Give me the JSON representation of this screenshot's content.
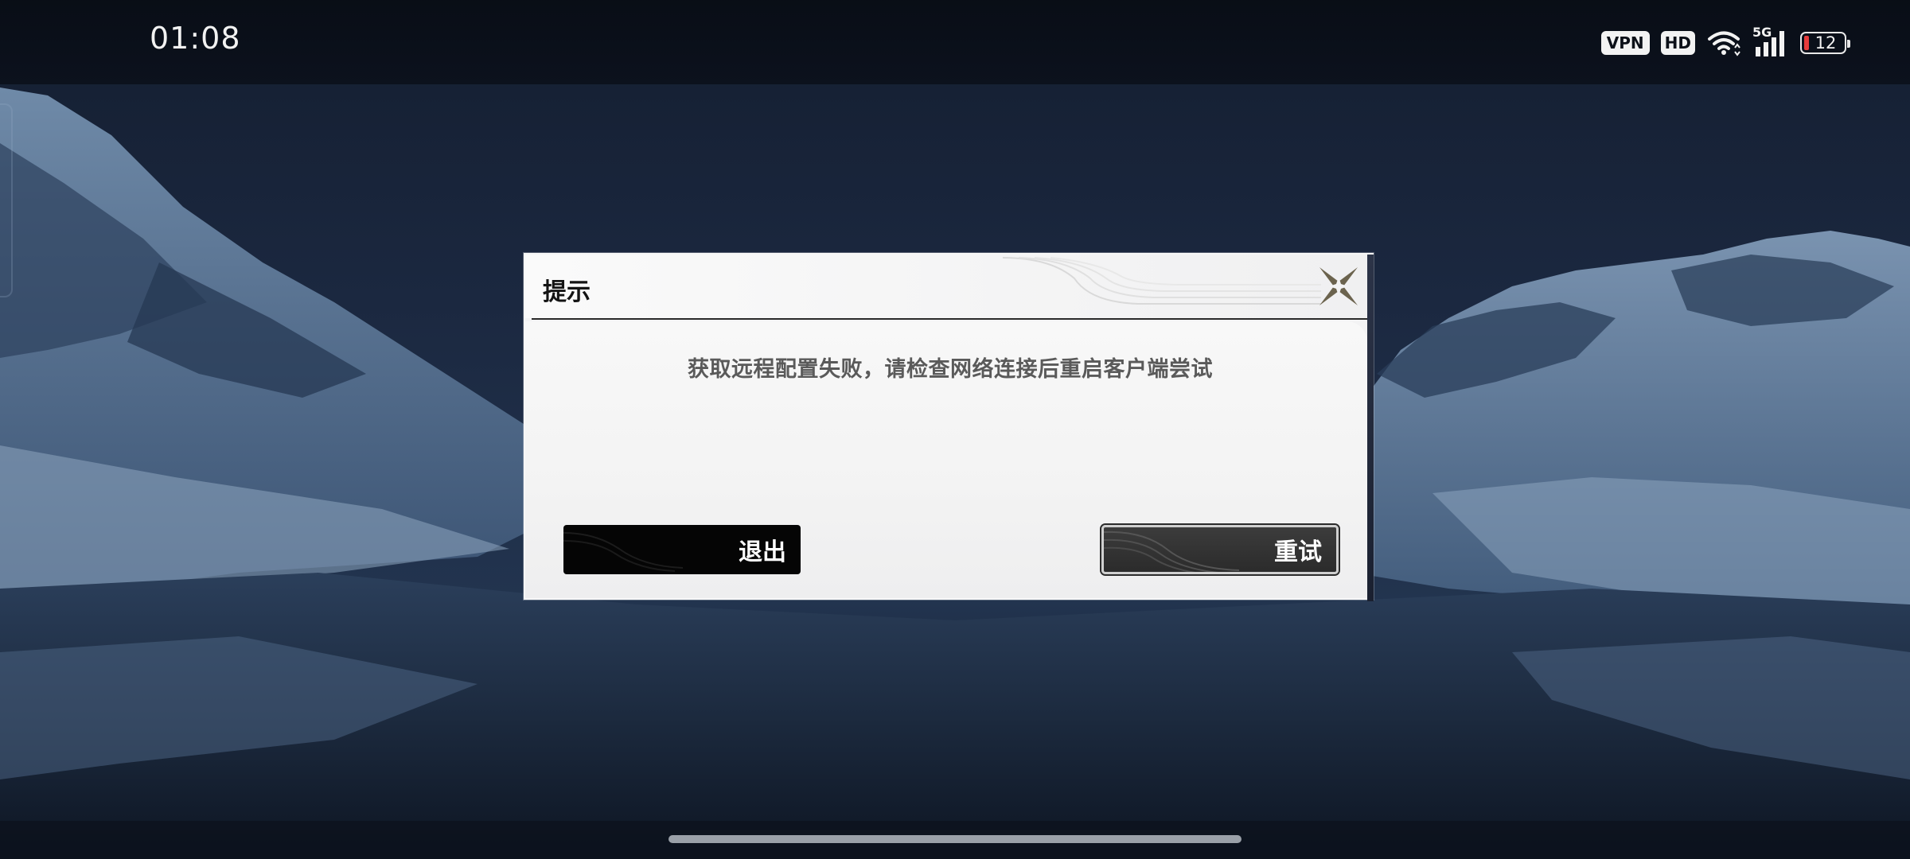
{
  "status_bar": {
    "time": "01:08",
    "vpn_label": "VPN",
    "hd_label": "HD",
    "network_label": "5G",
    "battery_level": "12",
    "battery_color": "#e53b3b"
  },
  "dialog": {
    "title": "提示",
    "message": "获取远程配置失败，请检查网络连接后重启客户端尝试",
    "exit_label": "退出",
    "retry_label": "重试",
    "close_icon": "close-x-icon"
  },
  "colors": {
    "background": "#1c2a40",
    "dialog": "#f3f3f4",
    "button_dark": "#050505"
  }
}
